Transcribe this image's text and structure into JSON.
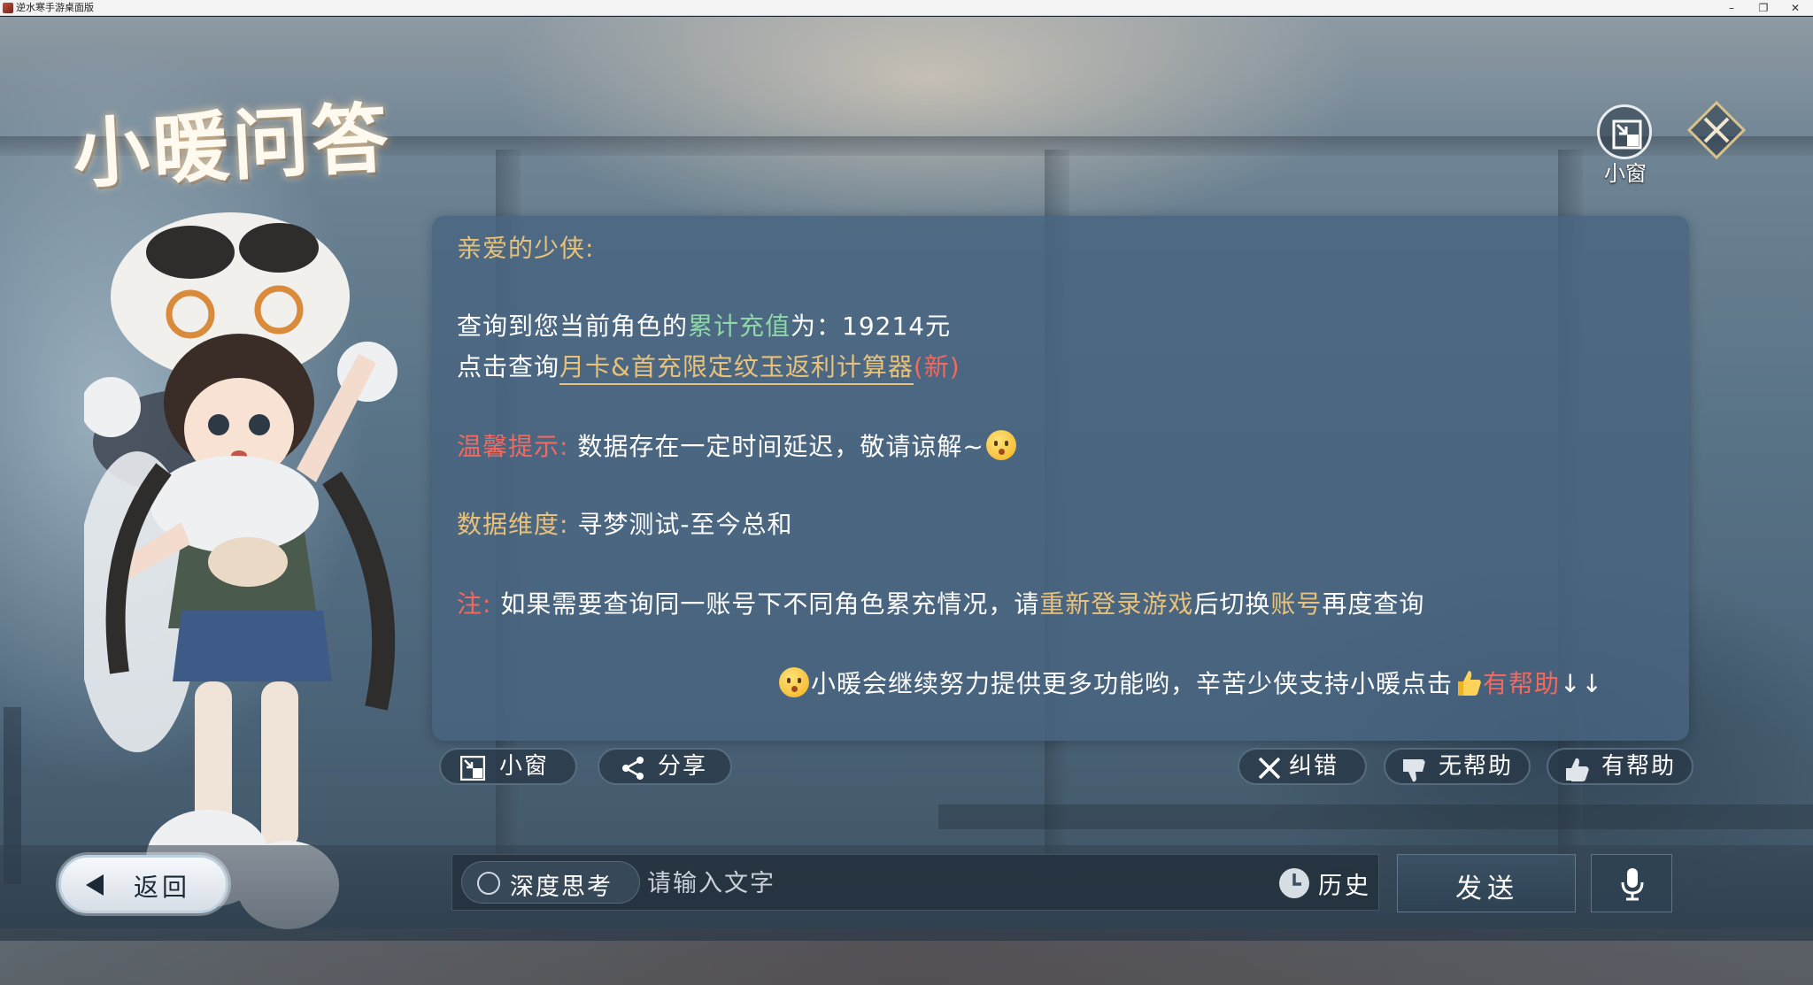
{
  "window": {
    "title": "逆水寒手游桌面版",
    "minimize_icon": "minimize-icon",
    "maximize_icon": "restore-icon",
    "close_icon": "close-icon"
  },
  "page": {
    "title": "小暖问答",
    "mini_window_label": "小窗",
    "close_icon": "diamond-close-icon"
  },
  "message": {
    "greeting": "亲爱的少侠:",
    "line1_prefix": "查询到您当前角色的",
    "line1_highlight": "累计充值",
    "line1_suffix": "为：19214元",
    "line2_prefix": "点击查询",
    "line2_link": "月卡&首充限定纹玉返利计算器",
    "line2_tag": "(新)",
    "tip_label": "温馨提示:",
    "tip_text": "数据存在一定时间延迟，敬请谅解~",
    "dimension_label": "数据维度:",
    "dimension_text": "寻梦测试-至今总和",
    "note_label": "注:",
    "note_prefix": "如果需要查询同一账号下不同角色累充情况，请",
    "note_relogin": "重新登录游戏",
    "note_mid": "后切换",
    "note_account": "账号",
    "note_suffix": "再度查询",
    "footer_text": "小暖会继续努力提供更多功能哟，辛苦少侠支持小暖点击",
    "footer_helpful": "有帮助",
    "footer_arrows": "↓↓"
  },
  "actions": {
    "mini_window": "小窗",
    "share": "分享",
    "correct": "纠错",
    "not_helpful": "无帮助",
    "helpful": "有帮助"
  },
  "bottom": {
    "back": "返回",
    "deep_think": "深度思考",
    "input_placeholder": "请输入文字",
    "history": "历史",
    "send": "发送"
  },
  "colors": {
    "gold": "#e8c27a",
    "green": "#8fd6a9",
    "red": "#f1695f",
    "bubble": "#48647f"
  }
}
